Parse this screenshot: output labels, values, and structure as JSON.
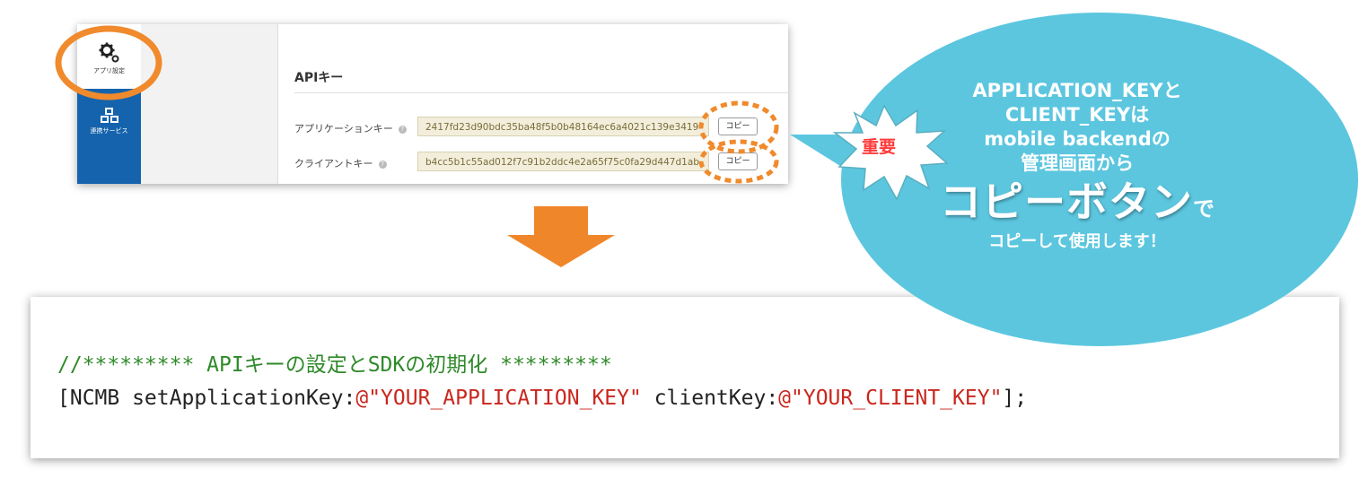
{
  "sidebar": {
    "items": [
      {
        "label": "アプリ設定",
        "icon": "gears-icon",
        "active": true
      },
      {
        "label": "連携サービス",
        "icon": "cubes-icon",
        "active": false
      }
    ]
  },
  "api_keys": {
    "title": "APIキー",
    "rows": [
      {
        "label": "アプリケーションキー",
        "value": "2417fd23d90bdc35ba48f5b0b48164ec6a4021c139e3419",
        "button": "コピー"
      },
      {
        "label": "クライアントキー",
        "value": "b4cc5b1c55ad012f7c91b2ddc4e2a65f75c0fa29d447d1ab",
        "button": "コピー"
      }
    ]
  },
  "callout": {
    "badge": "重要",
    "line1": "APPLICATION_KEYと",
    "line2": "CLIENT_KEYは",
    "line3": "mobile backendの",
    "line4": "管理画面から",
    "big": "コピーボタン",
    "big_suffix": "で",
    "line6": "コピーして使用します！"
  },
  "code": {
    "comment": "//********* APIキーの設定とSDKの初期化 *********",
    "prefix": "[NCMB setApplicationKey:",
    "app_key": "@\"YOUR_APPLICATION_KEY\"",
    "middle": " clientKey:",
    "client_key": "@\"YOUR_CLIENT_KEY\"",
    "suffix": "];"
  },
  "colors": {
    "sidebar": "#1563ad",
    "highlight_orange": "#f08a2c",
    "bubble": "#5cc6df",
    "string_red": "#c9271e",
    "comment_green": "#2f8a2a"
  }
}
